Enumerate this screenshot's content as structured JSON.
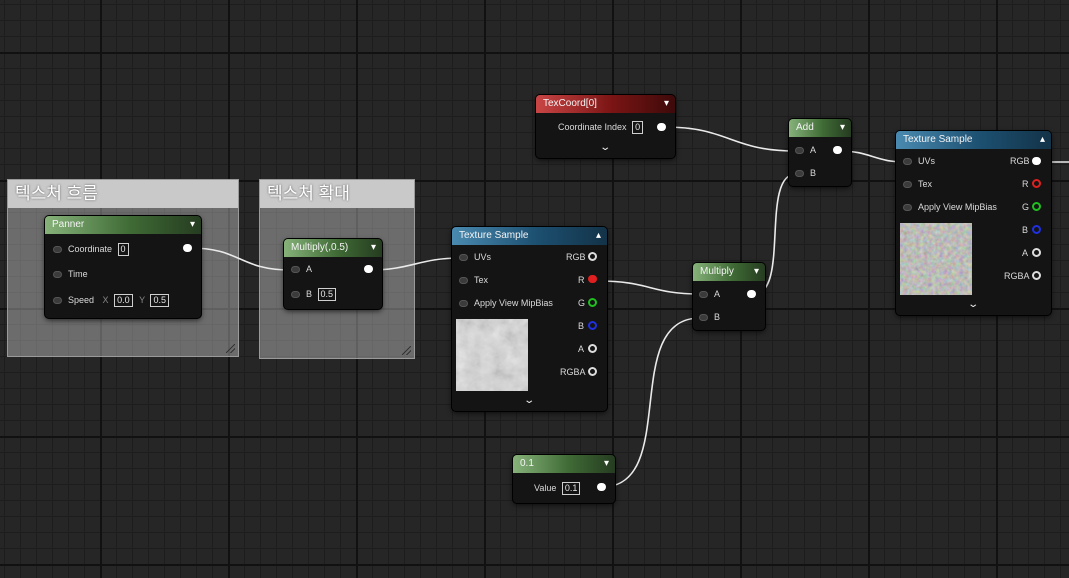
{
  "comments": [
    {
      "title": "텍스처 흐름"
    },
    {
      "title": "텍스처 확대"
    }
  ],
  "nodes": {
    "panner": {
      "title": "Panner",
      "coordinate_label": "Coordinate",
      "coordinate_value": "0",
      "time_label": "Time",
      "speed_label": "Speed",
      "speed_x_label": "X",
      "speed_x_value": "0.0",
      "speed_y_label": "Y",
      "speed_y_value": "0.5"
    },
    "multiply_half": {
      "title": "Multiply(,0.5)",
      "a_label": "A",
      "b_label": "B",
      "b_value": "0.5"
    },
    "texture_sample_1": {
      "title": "Texture Sample",
      "uvs_label": "UVs",
      "tex_label": "Tex",
      "mipbias_label": "Apply View MipBias",
      "rgb_label": "RGB",
      "r_label": "R",
      "g_label": "G",
      "b_label": "B",
      "a_label": "A",
      "rgba_label": "RGBA"
    },
    "texcoord": {
      "title": "TexCoord[0]",
      "index_label": "Coordinate Index",
      "index_value": "0"
    },
    "add": {
      "title": "Add",
      "a_label": "A",
      "b_label": "B"
    },
    "multiply": {
      "title": "Multiply",
      "a_label": "A",
      "b_label": "B"
    },
    "constant": {
      "title": "0.1",
      "value_label": "Value",
      "value": "0.1"
    },
    "texture_sample_2": {
      "title": "Texture Sample",
      "uvs_label": "UVs",
      "tex_label": "Tex",
      "mipbias_label": "Apply View MipBias",
      "rgb_label": "RGB",
      "r_label": "R",
      "g_label": "G",
      "b_label": "B",
      "a_label": "A",
      "rgba_label": "RGBA"
    }
  },
  "colors": {
    "r_pin": "#e02020",
    "g_pin": "#20c020",
    "b_pin": "#2030e0"
  },
  "icons": {
    "collapse": "chevron-down-icon",
    "expand": "chevron-up-icon"
  }
}
